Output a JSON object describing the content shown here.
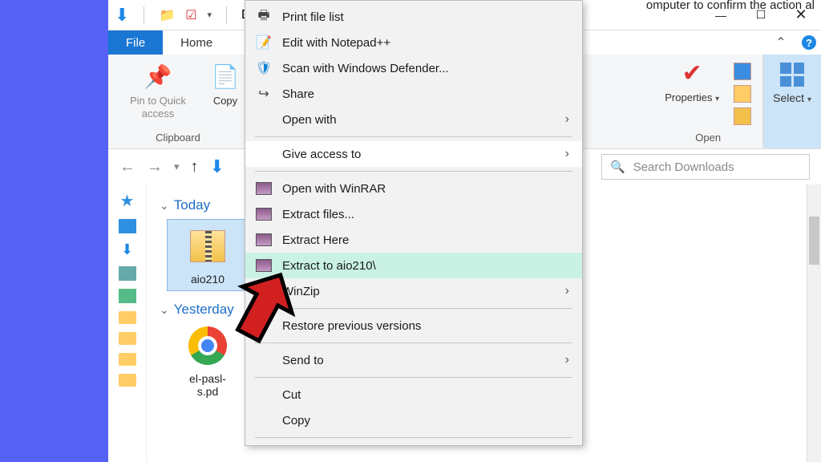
{
  "titlebar": {
    "prefix_truncated": "Do",
    "min_label": "—",
    "max_label": "☐",
    "close_label": "✕"
  },
  "top_truncated_text": "omputer to confirm the action al",
  "ribbon": {
    "file_tab": "File",
    "home_tab": "Home",
    "clipboard": {
      "label": "Clipboard",
      "pin": "Pin to Quick access",
      "copy": "Copy"
    },
    "open": {
      "label": "Open",
      "properties": "Properties"
    },
    "select": {
      "label": "Select"
    }
  },
  "nav": {
    "search_placeholder": "Search Downloads"
  },
  "content": {
    "today_heading": "Today",
    "yesterday_heading": "Yesterday",
    "file1": "aio210",
    "file2": "el-pasl-\ns.pd"
  },
  "context_menu": {
    "print_file_list": "Print file list",
    "edit_notepad": "Edit with Notepad++",
    "scan_defender": "Scan with Windows Defender...",
    "share": "Share",
    "open_with": "Open with",
    "give_access": "Give access to",
    "open_winrar": "Open with WinRAR",
    "extract_files": "Extract files...",
    "extract_here": "Extract Here",
    "extract_to": "Extract to aio210\\",
    "winzip": "WinZip",
    "restore": "Restore previous versions",
    "send_to": "Send to",
    "cut": "Cut",
    "copy": "Copy"
  }
}
